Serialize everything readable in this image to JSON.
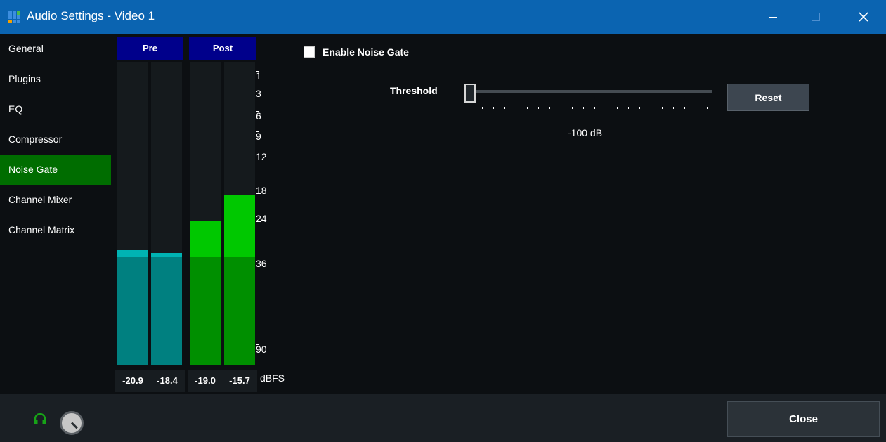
{
  "window": {
    "title": "Audio Settings - Video 1",
    "icon": "app-grid-icon",
    "controls": [
      "minimize-icon",
      "maximize-icon",
      "close-icon"
    ]
  },
  "sidebar": {
    "items": [
      {
        "label": "General",
        "active": false
      },
      {
        "label": "Plugins",
        "active": false
      },
      {
        "label": "EQ",
        "active": false
      },
      {
        "label": "Compressor",
        "active": false
      },
      {
        "label": "Noise Gate",
        "active": true
      },
      {
        "label": "Channel Mixer",
        "active": false
      },
      {
        "label": "Channel Matrix",
        "active": false
      }
    ]
  },
  "meters": {
    "pre_label": "Pre",
    "post_label": "Post",
    "unit": "dBFS",
    "scale_ticks": [
      "1",
      "3",
      "6",
      "9",
      "12",
      "18",
      "24",
      "36",
      "90"
    ],
    "channels": [
      {
        "group": "pre",
        "value": "-20.9"
      },
      {
        "group": "pre",
        "value": "-18.4"
      },
      {
        "group": "post",
        "value": "-19.0"
      },
      {
        "group": "post",
        "value": "-15.7"
      }
    ],
    "colors": {
      "pre_fill": "#008080",
      "pre_peak": "#00b3b3",
      "post_fill": "#008f00",
      "post_peak": "#00c800",
      "header_bg": "#00008b"
    }
  },
  "noise_gate": {
    "enable_label": "Enable Noise Gate",
    "enabled": false,
    "threshold_label": "Threshold",
    "threshold_value": "-100 dB",
    "slider_position": 0,
    "reset_label": "Reset"
  },
  "footer": {
    "monitor_icon": "headphones-icon",
    "volume_icon": "volume-knob-icon",
    "close_label": "Close"
  },
  "accent_color": "#006d00"
}
